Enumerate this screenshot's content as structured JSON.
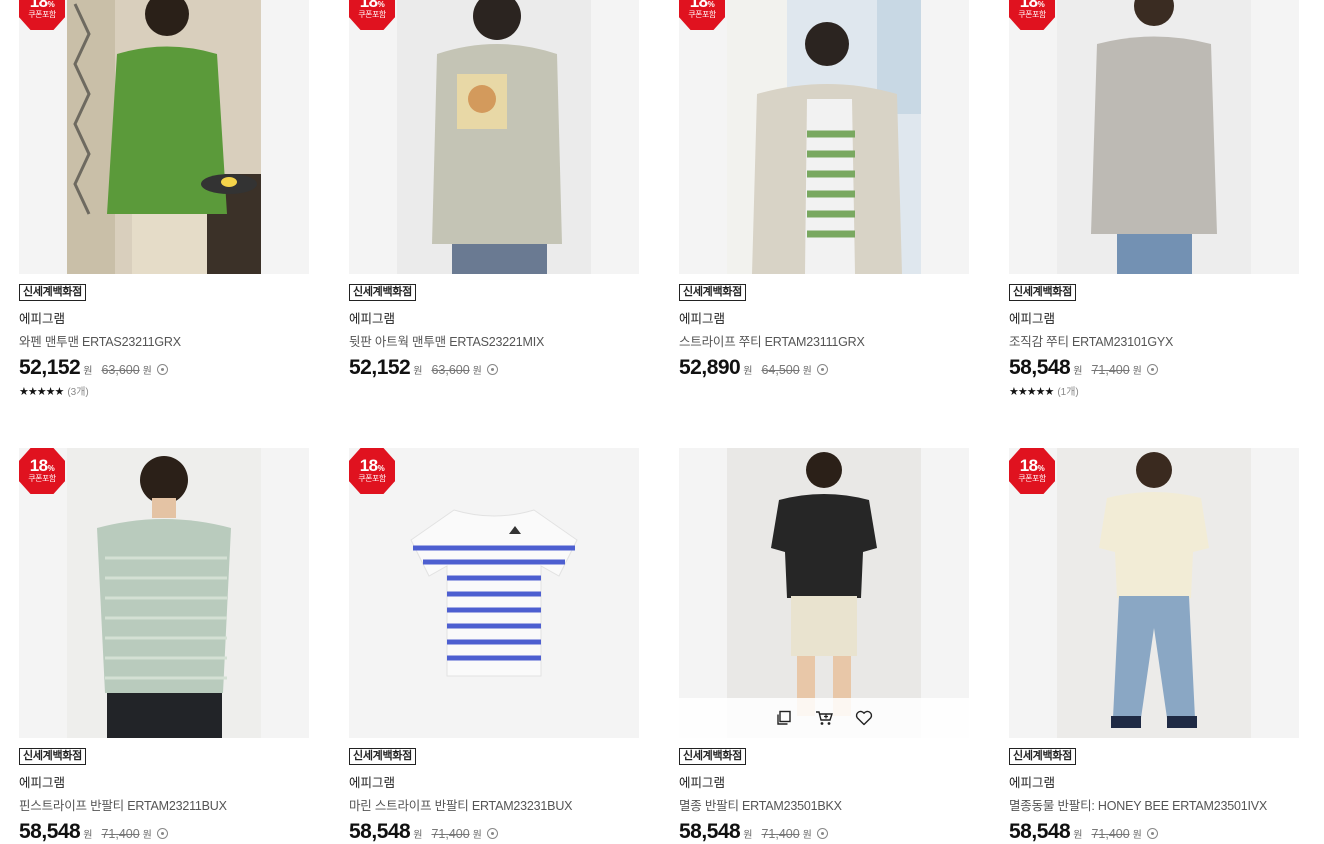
{
  "badges": {
    "coupon_percent": "18",
    "coupon_unit": "%",
    "coupon_label": "쿠폰포함",
    "store": "신세계백화점"
  },
  "currency": "원",
  "products": [
    {
      "brand": "에피그램",
      "name": "와펜 맨투맨 ERTAS23211GRX",
      "price": "52,152",
      "original_price": "63,600",
      "stars": "★★★★★",
      "review_count": "(3개)"
    },
    {
      "brand": "에피그램",
      "name": "뒷판 아트웍 맨투맨 ERTAS23221MIX",
      "price": "52,152",
      "original_price": "63,600"
    },
    {
      "brand": "에피그램",
      "name": "스트라이프 쭈티 ERTAM23111GRX",
      "price": "52,890",
      "original_price": "64,500"
    },
    {
      "brand": "에피그램",
      "name": "조직감 쭈티 ERTAM23101GYX",
      "price": "58,548",
      "original_price": "71,400",
      "stars": "★★★★★",
      "review_count": "(1개)"
    },
    {
      "brand": "에피그램",
      "name": "핀스트라이프 반팔티 ERTAM23211BUX",
      "price": "58,548",
      "original_price": "71,400"
    },
    {
      "brand": "에피그램",
      "name": "마린 스트라이프 반팔티 ERTAM23231BUX",
      "price": "58,548",
      "original_price": "71,400"
    },
    {
      "brand": "에피그램",
      "name": "멸종 반팔티 ERTAM23501BKX",
      "price": "58,548",
      "original_price": "71,400"
    },
    {
      "brand": "에피그램",
      "name": "멸종동물 반팔티: HONEY BEE ERTAM23501IVX",
      "price": "58,548",
      "original_price": "71,400"
    }
  ],
  "hover_actions": [
    "compare-icon",
    "cart-icon",
    "heart-icon"
  ],
  "colors": {
    "coupon_red": "#e0121f",
    "page_bg": "#ffffff",
    "thumb_bg": "#f4f4f4"
  }
}
